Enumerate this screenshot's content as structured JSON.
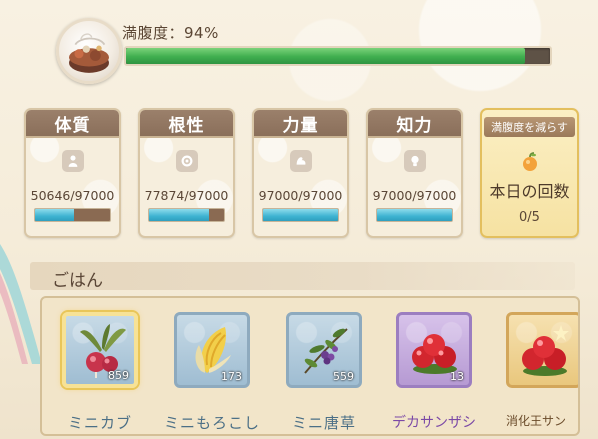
{
  "satiety": {
    "label": "満腹度：94%",
    "percent": 94,
    "icon": "cooking-pot-icon"
  },
  "stats": [
    {
      "name": "体質",
      "value": "50646/97000",
      "current": 50646,
      "max": 97000,
      "icon": "body-icon"
    },
    {
      "name": "根性",
      "value": "77874/97000",
      "current": 77874,
      "max": 97000,
      "icon": "gear-icon"
    },
    {
      "name": "力量",
      "value": "97000/97000",
      "current": 97000,
      "max": 97000,
      "icon": "arm-icon"
    },
    {
      "name": "知力",
      "value": "97000/97000",
      "current": 97000,
      "max": 97000,
      "icon": "bulb-icon"
    }
  ],
  "limit_card": {
    "header": "満腹度を減らす",
    "title": "本日の回数",
    "count": "0/5",
    "icon": "apple-icon"
  },
  "food": {
    "section_title": "ごはん",
    "items": [
      {
        "name": "ミニカブ",
        "qty": "859",
        "rarity": "blue",
        "selected": true,
        "icon": "turnip-icon"
      },
      {
        "name": "ミニもろこし",
        "qty": "173",
        "rarity": "blue",
        "selected": false,
        "icon": "corn-icon"
      },
      {
        "name": "ミニ唐草",
        "qty": "559",
        "rarity": "blue",
        "selected": false,
        "icon": "herb-icon"
      },
      {
        "name": "デカサンザシ",
        "qty": "13",
        "rarity": "purple",
        "selected": false,
        "icon": "hawthorn-icon"
      },
      {
        "name": "消化王サン",
        "qty": "",
        "rarity": "gold",
        "selected": false,
        "icon": "hawthorn-icon"
      }
    ]
  },
  "colors": {
    "satiety_fill": "#3fae4f",
    "stat_fill": "#3eb3d1",
    "rarity_blue": "#9fbdd2",
    "rarity_purple": "#b69ad3",
    "rarity_gold": "#e9c77d"
  }
}
